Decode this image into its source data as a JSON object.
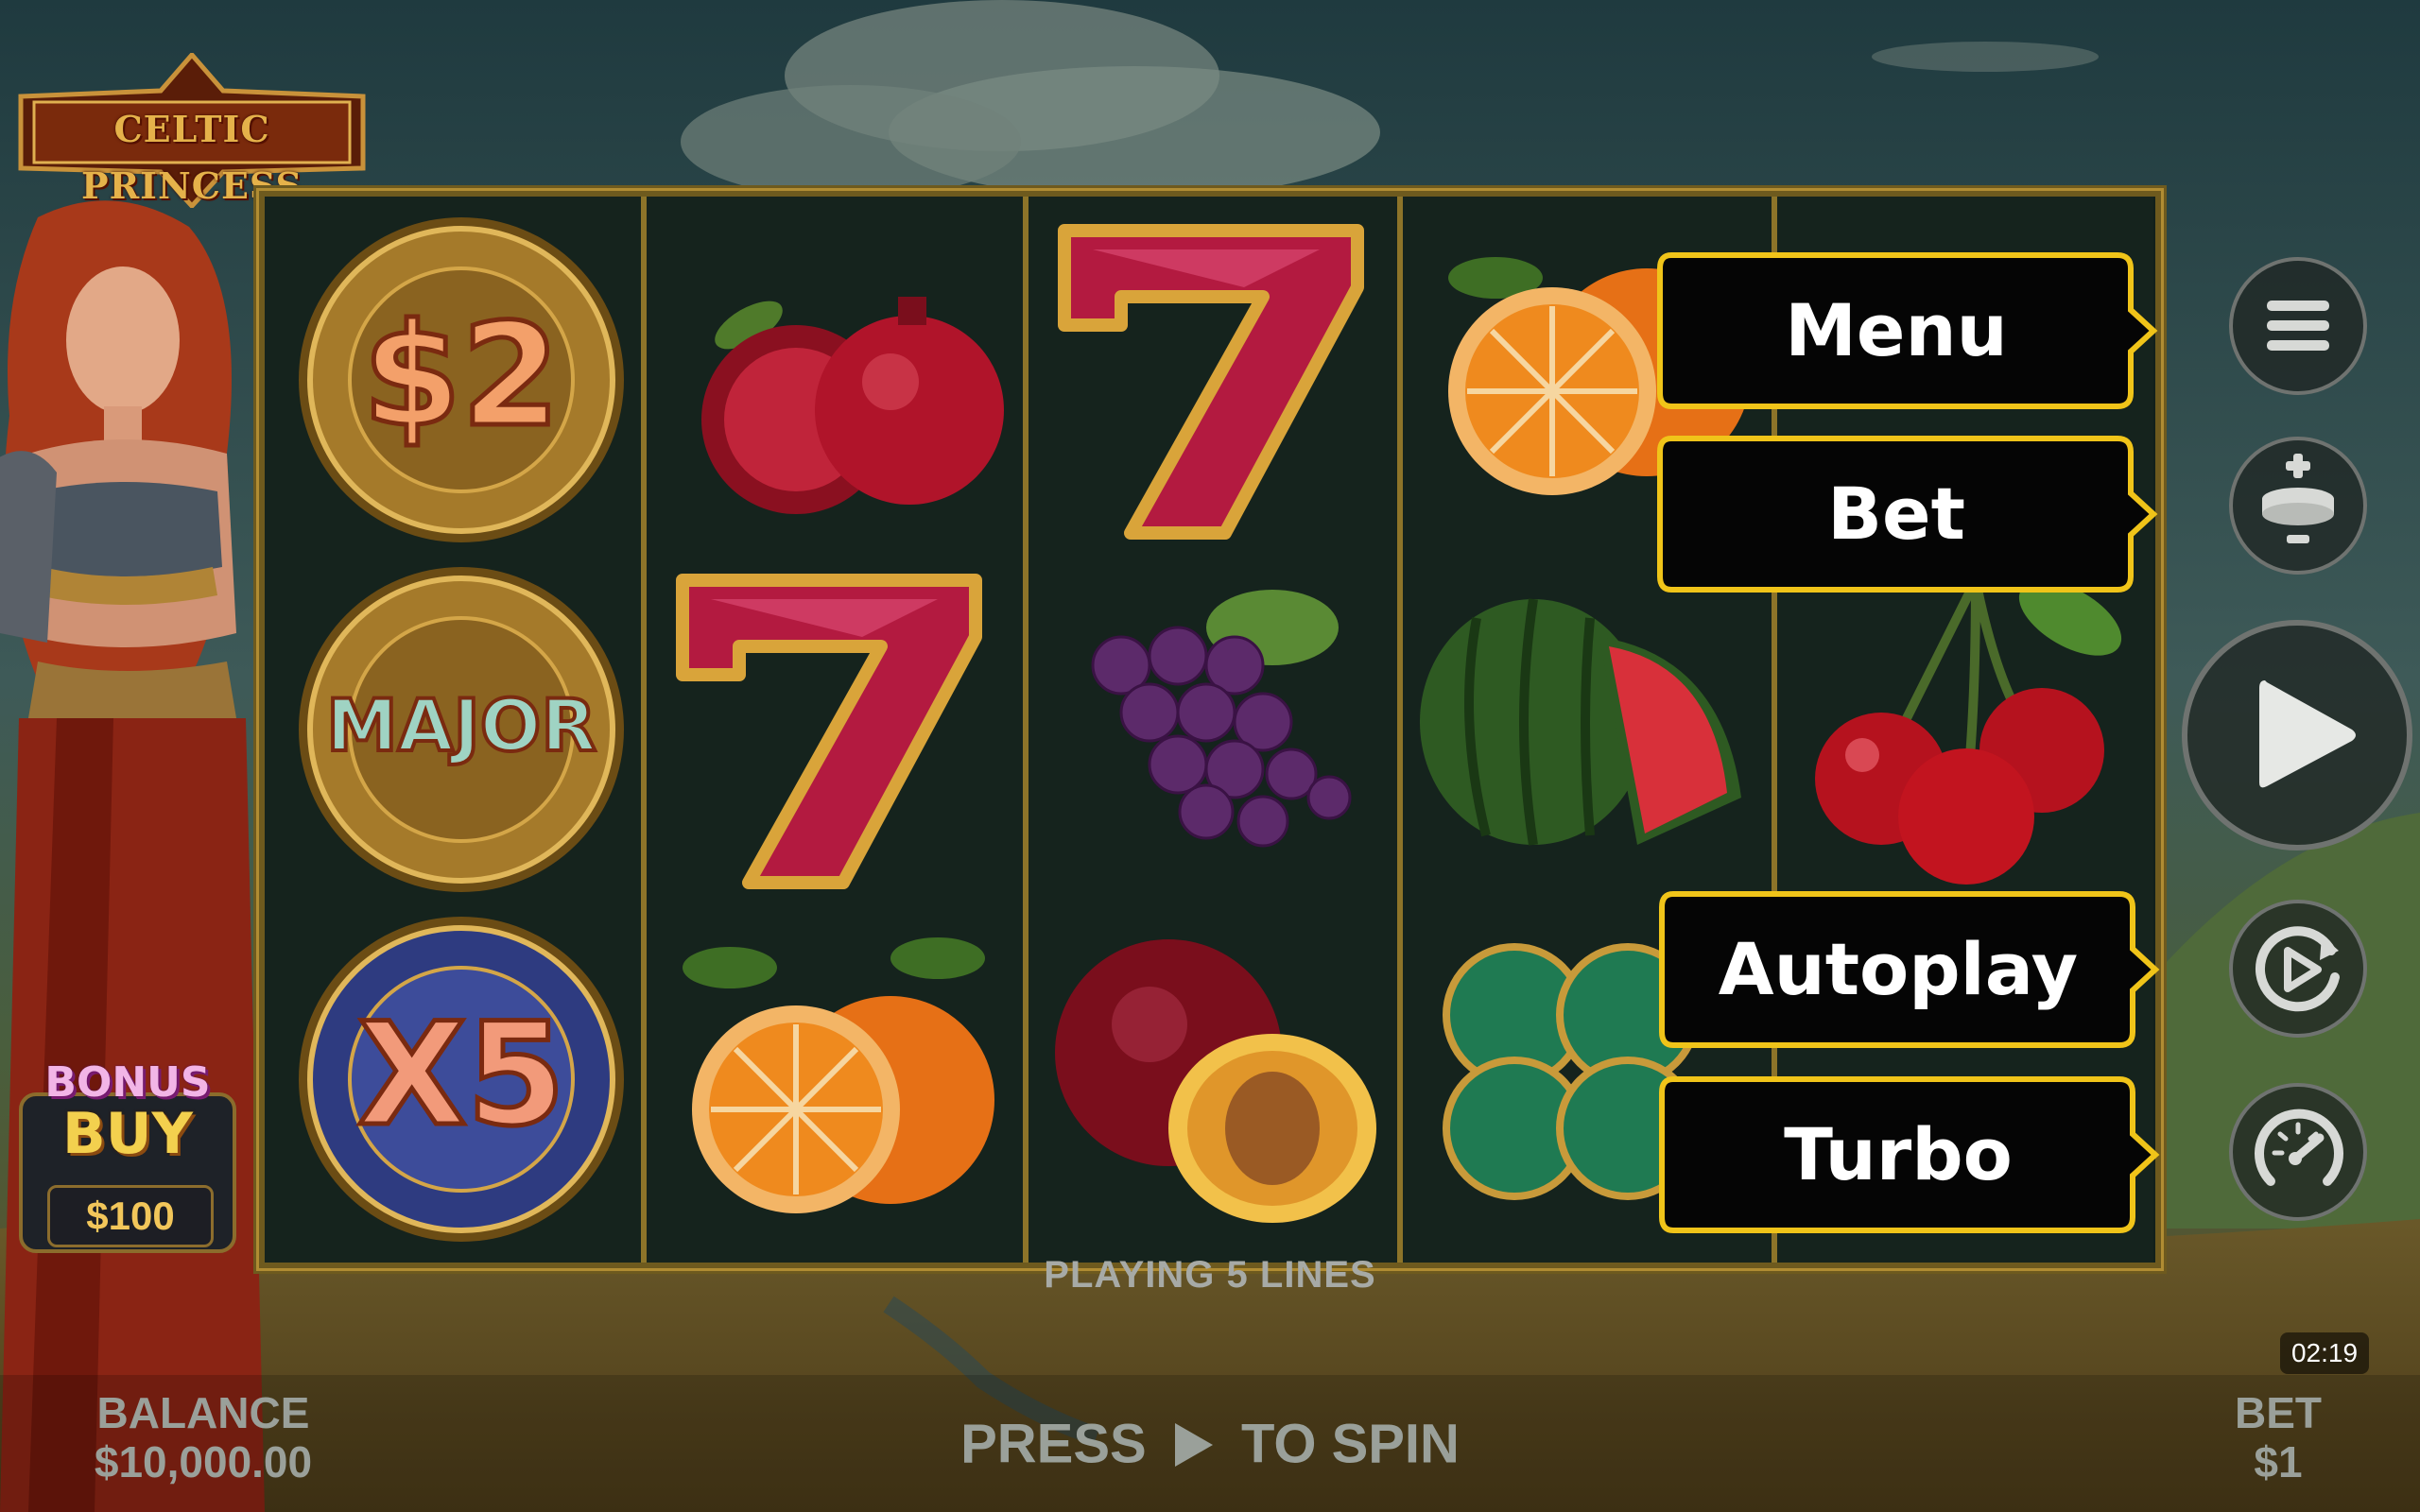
{
  "game": {
    "logo_text": "CELTIC PRINCESS"
  },
  "reels": {
    "columns": [
      [
        "coin-$2",
        "coin-major",
        "coin-x5"
      ],
      [
        "pomegranate",
        "red-seven",
        "orange"
      ],
      [
        "red-seven",
        "grapes",
        "plum"
      ],
      [
        "orange",
        "watermelon",
        "clover"
      ],
      [
        "hidden",
        "cherries",
        "hidden"
      ]
    ],
    "coin_labels": {
      "c1": "$2",
      "c2": "MAJOR",
      "c3": "X5"
    }
  },
  "bonus_buy": {
    "title_top": "BONUS",
    "title_bottom": "BUY",
    "price": "$100"
  },
  "tooltips": {
    "menu": "Menu",
    "bet": "Bet",
    "autoplay": "Autoplay",
    "turbo": "Turbo"
  },
  "side_buttons": [
    "menu-icon",
    "bet-coin-icon",
    "play-icon",
    "autoplay-icon",
    "turbo-gauge-icon"
  ],
  "status": {
    "playing_lines": "PLAYING 5 LINES",
    "clock": "02:19"
  },
  "footer": {
    "balance_label": "BALANCE",
    "balance_value": "$10,000.00",
    "press_word": "PRESS",
    "to_spin": "TO SPIN",
    "bet_label": "BET",
    "bet_value": "$1"
  },
  "colors": {
    "tooltip_border": "#f0c419",
    "tooltip_bg": "#050505",
    "frame_gold": "#8d7429"
  }
}
